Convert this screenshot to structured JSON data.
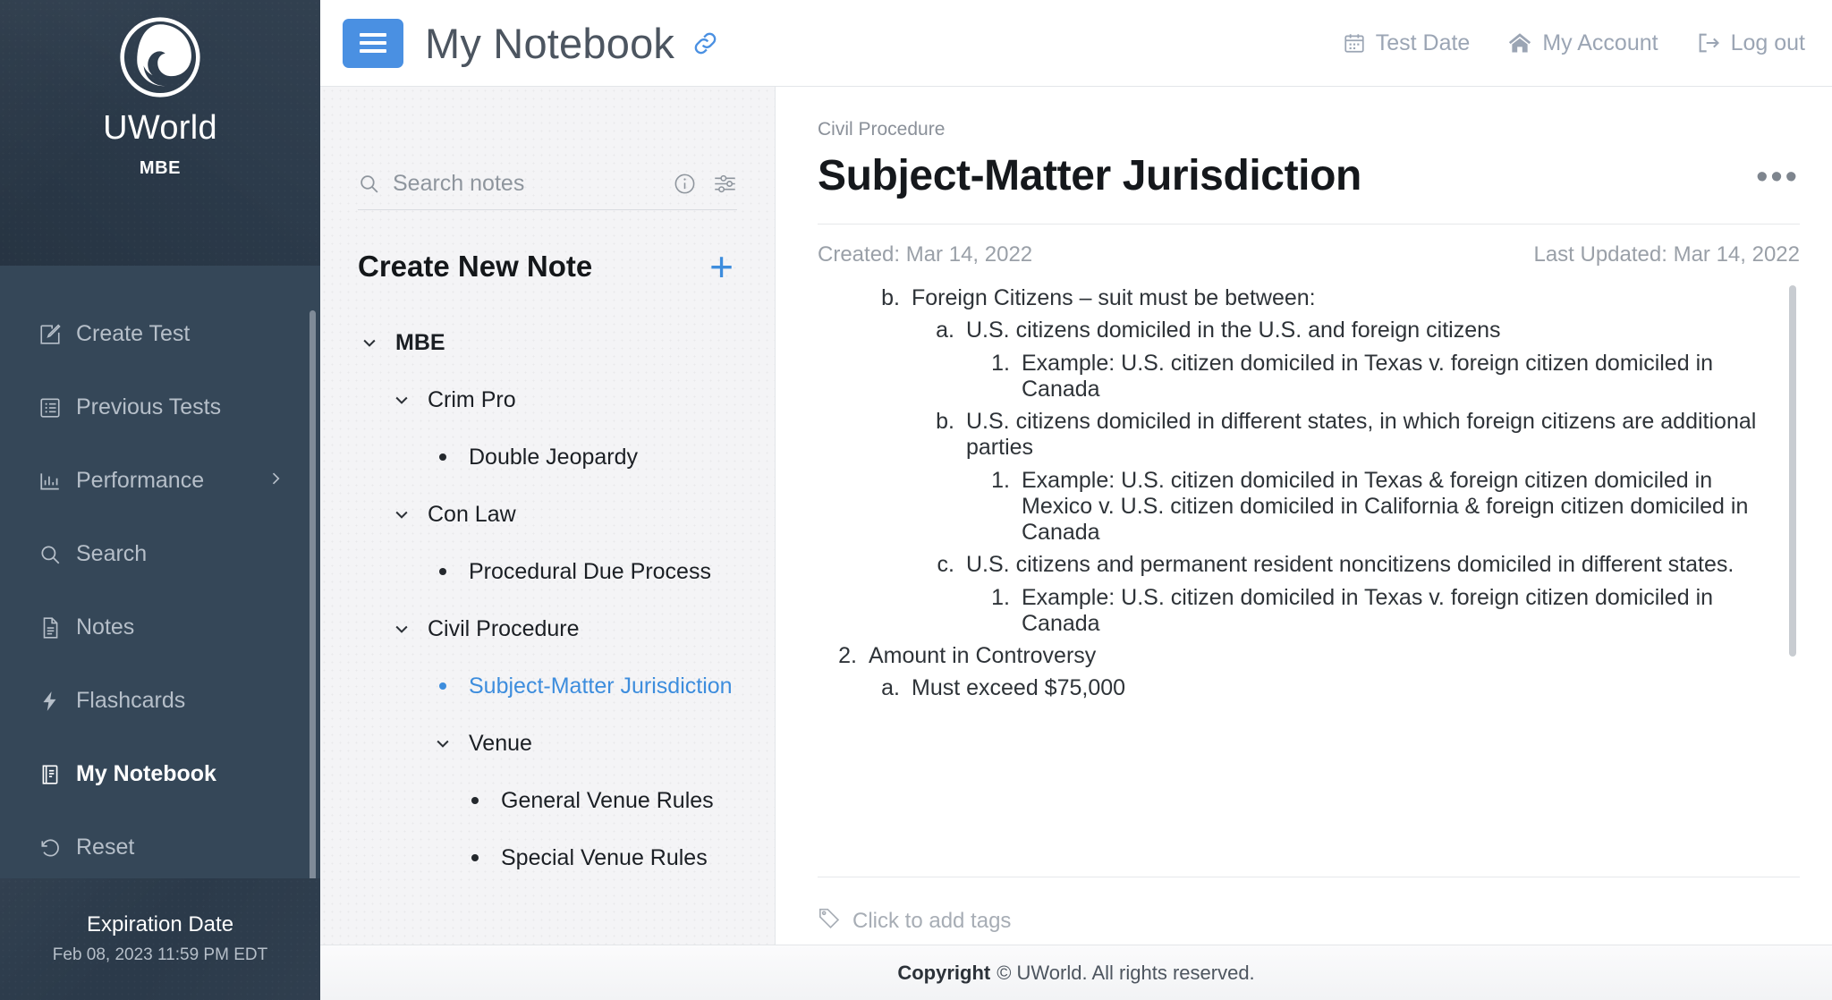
{
  "brand": {
    "logo_icon": "uworld-swirl-logo",
    "name": "UWorld",
    "product": "MBE"
  },
  "sidebar": {
    "items": [
      {
        "label": "Create Test",
        "icon": "pencil-square-icon",
        "active": false,
        "chevron": false
      },
      {
        "label": "Previous Tests",
        "icon": "list-box-icon",
        "active": false,
        "chevron": false
      },
      {
        "label": "Performance",
        "icon": "bar-chart-icon",
        "active": false,
        "chevron": true
      },
      {
        "label": "Search",
        "icon": "magnifier-icon",
        "active": false,
        "chevron": false
      },
      {
        "label": "Notes",
        "icon": "document-icon",
        "active": false,
        "chevron": false
      },
      {
        "label": "Flashcards",
        "icon": "bolt-icon",
        "active": false,
        "chevron": false
      },
      {
        "label": "My Notebook",
        "icon": "notebook-icon",
        "active": true,
        "chevron": false
      },
      {
        "label": "Reset",
        "icon": "undo-arrow-icon",
        "active": false,
        "chevron": false
      }
    ],
    "footer": {
      "expiration_title": "Expiration Date",
      "expiration_value": "Feb 08, 2023 11:59 PM EDT"
    }
  },
  "topbar": {
    "menu_icon": "hamburger-menu-icon",
    "title": "My Notebook",
    "link_icon": "chain-link-icon",
    "links": [
      {
        "label": "Test Date",
        "icon": "calendar-icon"
      },
      {
        "label": "My Account",
        "icon": "home-icon"
      },
      {
        "label": "Log out",
        "icon": "logout-icon"
      }
    ]
  },
  "tree_panel": {
    "search": {
      "placeholder": "Search notes",
      "value": "",
      "search_icon": "magnifier-icon",
      "info_icon": "info-circle-icon",
      "filter_icon": "sliders-icon"
    },
    "create_new_note_label": "Create New Note",
    "add_icon": "plus-icon",
    "nodes": [
      {
        "label": "MBE",
        "type": "folder",
        "level": 0,
        "expanded": true,
        "selected": false
      },
      {
        "label": "Crim Pro",
        "type": "folder",
        "level": 1,
        "expanded": true,
        "selected": false
      },
      {
        "label": "Double Jeopardy",
        "type": "note",
        "level": 2,
        "expanded": false,
        "selected": false
      },
      {
        "label": "Con Law",
        "type": "folder",
        "level": 1,
        "expanded": true,
        "selected": false
      },
      {
        "label": "Procedural Due Process",
        "type": "note",
        "level": 2,
        "expanded": false,
        "selected": false
      },
      {
        "label": "Civil Procedure",
        "type": "folder",
        "level": 1,
        "expanded": true,
        "selected": false
      },
      {
        "label": "Subject-Matter Jurisdiction",
        "type": "note",
        "level": 2,
        "expanded": false,
        "selected": true
      },
      {
        "label": "Venue",
        "type": "folder",
        "level": 2,
        "expanded": true,
        "selected": false
      },
      {
        "label": "General Venue Rules",
        "type": "note",
        "level": 3,
        "expanded": false,
        "selected": false
      },
      {
        "label": "Special Venue Rules",
        "type": "note",
        "level": 3,
        "expanded": false,
        "selected": false
      }
    ]
  },
  "note": {
    "breadcrumb": "Civil Procedure",
    "title": "Subject-Matter Jurisdiction",
    "more_icon": "ellipsis-icon",
    "created": "Created: Mar 14, 2022",
    "last_updated": "Last Updated: Mar 14, 2022",
    "content": {
      "b_heading_mark": "b.",
      "b_heading_text": "Foreign Citizens – suit must be between:",
      "items": [
        {
          "mark": "a.",
          "text": "U.S. citizens domiciled in the U.S. and foreign citizens",
          "sub": [
            {
              "mark": "1.",
              "text": "Example:  U.S. citizen domiciled in Texas v. foreign citizen domiciled in Canada"
            }
          ]
        },
        {
          "mark": "b.",
          "text": "U.S. citizens domiciled in different states, in which foreign citizens are additional parties",
          "sub": [
            {
              "mark": "1.",
              "text": "Example:  U.S. citizen domiciled in Texas & foreign citizen domiciled in Mexico v. U.S. citizen domiciled in California & foreign citizen domiciled in Canada"
            }
          ]
        },
        {
          "mark": "c.",
          "text": "U.S. citizens and permanent resident noncitizens domiciled in different states.",
          "sub": [
            {
              "mark": "1.",
              "text": "Example:  U.S. citizen domiciled in Texas v. foreign citizen domiciled in Canada"
            }
          ]
        }
      ],
      "amount_mark": "2.",
      "amount_text": "Amount in Controversy",
      "amount_sub_mark": "a.",
      "amount_sub_text": "Must exceed $75,000"
    },
    "tags": {
      "icon": "tag-icon",
      "placeholder": "Click to add tags"
    }
  },
  "footer": {
    "copyright_bold": "Copyright",
    "copyright_rest": "© UWorld. All rights reserved."
  },
  "colors": {
    "sidebar_bg": "#354758",
    "sidebar_dark": "#2b3a4a",
    "accent_blue": "#4a90e2",
    "link_blue": "#3d8ddd",
    "tree_bg": "#f4f4f6"
  }
}
